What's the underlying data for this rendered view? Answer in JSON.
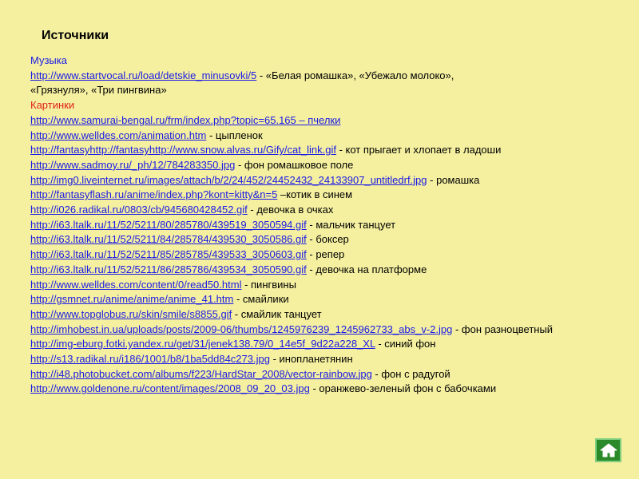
{
  "title": "Источники",
  "music_heading": "Музыка",
  "music": {
    "url": "http://www.startvocal.ru/load/detskie_minusovki/5",
    "desc_a": " - «Белая ромашка», «Убежало молоко»,",
    "desc_b": "«Грязнуля», «Три пингвина»"
  },
  "pictures_heading": "Картинки",
  "pictures": [
    {
      "url": "http://www.samurai-bengal.ru/frm/index.php?topic=65.165 – пчелки",
      "desc": ""
    },
    {
      "url": "http://www.welldes.com/animation.htm",
      "desc": " - цыпленок"
    },
    {
      "url": "http://fantasyhttp://fantasyhttp://www.snow.alvas.ru/Gify/cat_link.gif",
      "desc": " - кот прыгает и хлопает в ладоши"
    },
    {
      "url": "http://www.sadmoy.ru/_ph/12/784283350.jpg",
      "desc": " - фон ромашковое поле"
    },
    {
      "url": "http://img0.liveinternet.ru/images/attach/b/2/24/452/24452432_24133907_untitledrf.jpg",
      "desc": " - ромашка"
    },
    {
      "url": "http://fantasyflash.ru/anime/index.php?kont=kitty&n=5",
      "desc": " –котик в синем"
    },
    {
      "url": "http://i026.radikal.ru/0803/cb/945680428452.gif",
      "desc": " - девочка в очках"
    },
    {
      "url": "http://i63.ltalk.ru/11/52/5211/80/285780/439519_3050594.gif",
      "desc": " - мальчик танцует"
    },
    {
      "url": "http://i63.ltalk.ru/11/52/5211/84/285784/439530_3050586.gif",
      "desc": " -  боксер"
    },
    {
      "url": "http://i63.ltalk.ru/11/52/5211/85/285785/439533_3050603.gif",
      "desc": " - репер"
    },
    {
      "url": "http://i63.ltalk.ru/11/52/5211/86/285786/439534_3050590.gif",
      "desc": " - девочка на платформе"
    },
    {
      "url": "http://www.welldes.com/content/0/read50.html",
      "desc": " - пингвины"
    },
    {
      "url": "http://gsmnet.ru/anime/anime/anime_41.htm",
      "desc": " - смайлики"
    },
    {
      "url": "http://www.topglobus.ru/skin/smile/s8855.gif",
      "desc": " - смайлик танцует"
    },
    {
      "url": "http://imhobest.in.ua/uploads/posts/2009-06/thumbs/1245976239_1245962733_abs_v-2.jpg",
      "desc": " -  фон разноцветный"
    },
    {
      "url": "http://img-eburg.fotki.yandex.ru/get/31/jenek138.79/0_14e5f_9d22a228_XL",
      "desc": " - синий фон"
    },
    {
      "url": "http://s13.radikal.ru/i186/1001/b8/1ba5dd84c273.jpg",
      "desc": " - инопланетянин"
    },
    {
      "url": "http://i48.photobucket.com/albums/f223/HardStar_2008/vector-rainbow.jpg",
      "desc": " -   фон с  радугой"
    },
    {
      "url": "http://www.goldenone.ru/content/images/2008_09_20_03.jpg",
      "desc": " - оранжево-зеленый  фон с бабочками"
    }
  ],
  "home_icon": "home-icon",
  "colors": {
    "background": "#f5f0a0",
    "link": "#1a1ae6",
    "pictures_heading": "#e0201a",
    "home_button": "#2a8a2a"
  }
}
